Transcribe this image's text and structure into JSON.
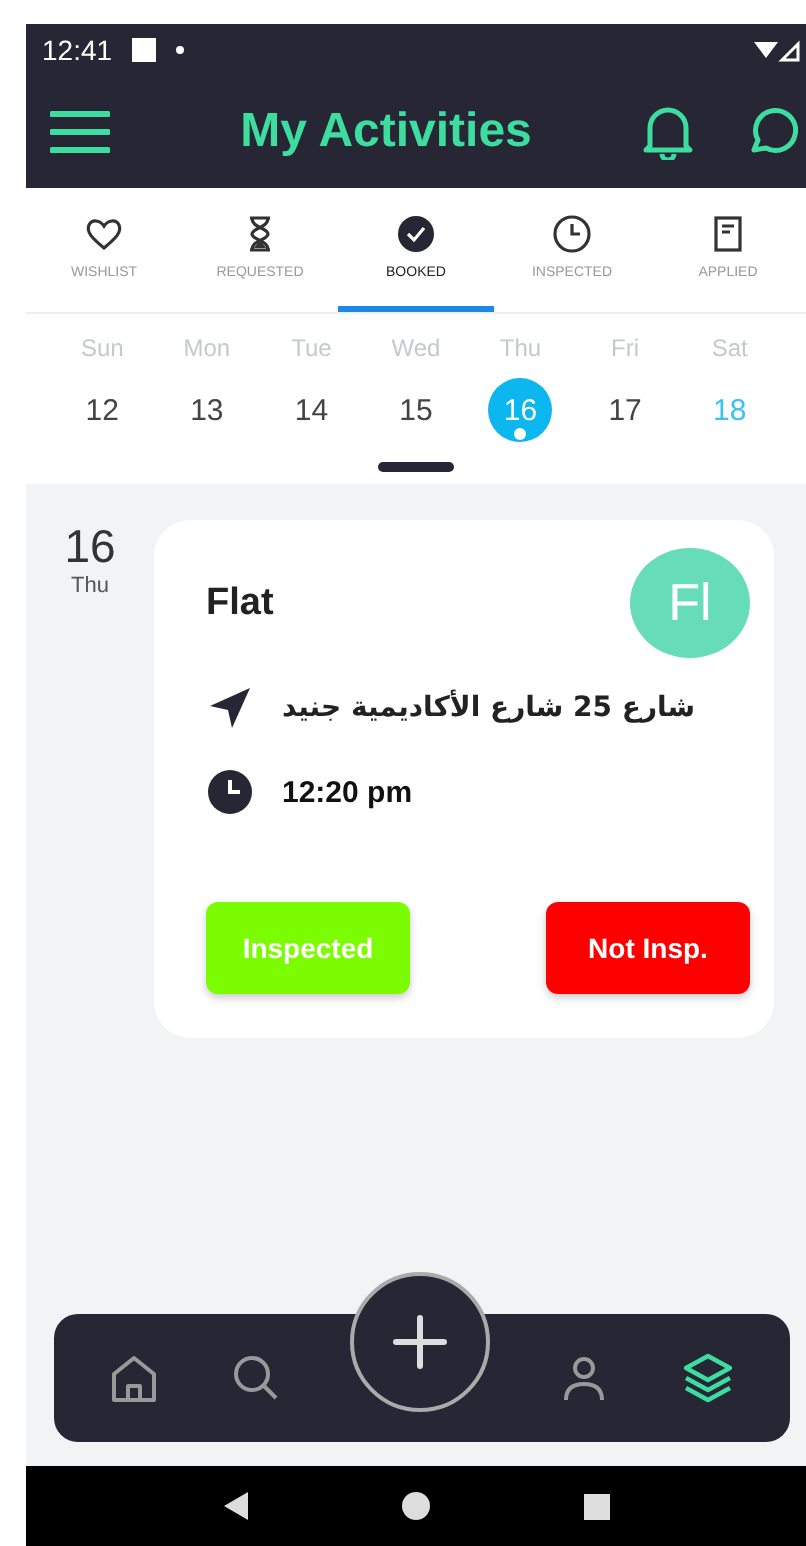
{
  "status_bar": {
    "time": "12:41"
  },
  "header": {
    "title": "My Activities"
  },
  "tabs": [
    {
      "label": "WISHLIST",
      "kind": "heart",
      "selected": false
    },
    {
      "label": "REQUESTED",
      "kind": "hourglass",
      "selected": false
    },
    {
      "label": "BOOKED",
      "kind": "check",
      "selected": true
    },
    {
      "label": "INSPECTED",
      "kind": "clock",
      "selected": false
    },
    {
      "label": "APPLIED",
      "kind": "document",
      "selected": false
    }
  ],
  "week": [
    {
      "weekday": "Sun",
      "date": "12",
      "selected": false,
      "today": false,
      "has_event": false
    },
    {
      "weekday": "Mon",
      "date": "13",
      "selected": false,
      "today": false,
      "has_event": false
    },
    {
      "weekday": "Tue",
      "date": "14",
      "selected": false,
      "today": false,
      "has_event": false
    },
    {
      "weekday": "Wed",
      "date": "15",
      "selected": false,
      "today": false,
      "has_event": false
    },
    {
      "weekday": "Thu",
      "date": "16",
      "selected": true,
      "today": false,
      "has_event": true
    },
    {
      "weekday": "Fri",
      "date": "17",
      "selected": false,
      "today": false,
      "has_event": false
    },
    {
      "weekday": "Sat",
      "date": "18",
      "selected": false,
      "today": true,
      "has_event": false
    }
  ],
  "agenda": [
    {
      "day": "16",
      "weekday": "Thu",
      "title": "Flat",
      "avatar": "Fl",
      "address": "شارع 25 شارع الأكاديمية جنيد",
      "time": "12:20 pm",
      "actions": [
        {
          "label": "Inspected",
          "kind": "positive"
        },
        {
          "label": "Not Insp.",
          "kind": "negative"
        }
      ]
    }
  ],
  "bottom_nav": [
    {
      "kind": "home",
      "selected": false
    },
    {
      "kind": "search",
      "selected": false
    },
    {
      "kind": "add",
      "selected": false
    },
    {
      "kind": "person",
      "selected": false
    },
    {
      "kind": "layers",
      "selected": true
    }
  ]
}
